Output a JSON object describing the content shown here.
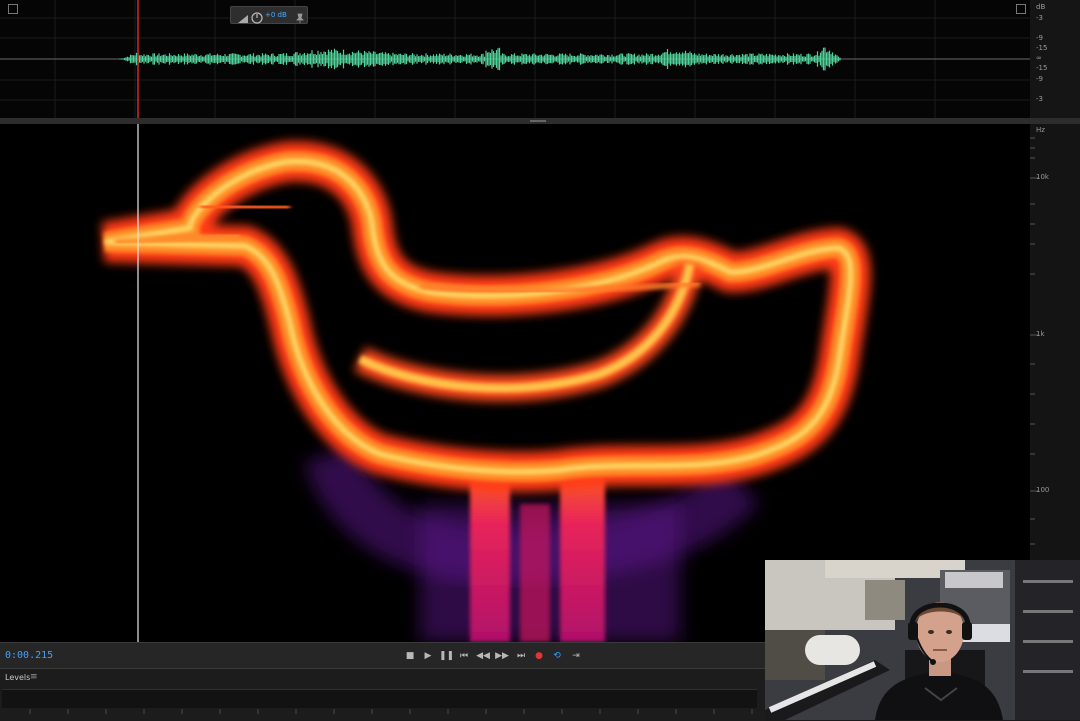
{
  "waveform": {
    "tool_readout": "+0 dB",
    "db_scale": [
      "dB",
      "-3",
      "-9",
      "-15",
      "∞",
      "-15",
      "-9",
      "-3"
    ],
    "colors": {
      "wave": "#4fd39b",
      "playhead": "#d02b2b"
    }
  },
  "spectral": {
    "hz_scale": [
      "Hz",
      "10k",
      "1k",
      "100"
    ],
    "colors": {
      "hot": "#fff27a",
      "mid": "#ff5a14",
      "cool": "#c0135a",
      "faint": "#4a0f7a"
    }
  },
  "transport": {
    "current_time": "0:00.215",
    "icons": [
      "stop-icon",
      "play-icon",
      "pause-icon",
      "skip-start-icon",
      "rewind-icon",
      "fast-forward-icon",
      "skip-end-icon",
      "record-icon",
      "loop-icon",
      "skip-selection-icon"
    ],
    "colors": {
      "time": "#3ea0ff",
      "record": "#e23434",
      "loop": "#3ea0ff"
    }
  },
  "levels": {
    "title": "Levels",
    "menu_glyph": "≡"
  },
  "webcam": {
    "description_icon": "webcam-feed"
  }
}
